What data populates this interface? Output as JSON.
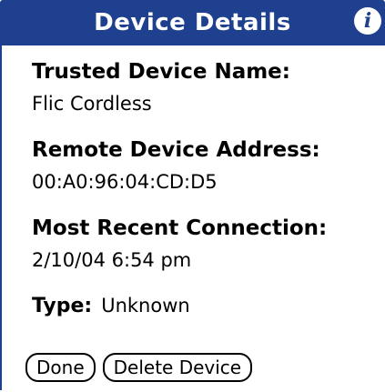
{
  "header": {
    "title": "Device Details",
    "info_icon": "info-icon",
    "bar_color": "#1f3f8f"
  },
  "details": {
    "trusted_name_label": "Trusted Device Name:",
    "trusted_name_value": "Flic Cordless",
    "address_label": "Remote Device Address:",
    "address_value": "00:A0:96:04:CD:D5",
    "recent_label": "Most Recent Connection:",
    "recent_value": "2/10/04 6:54 pm",
    "type_label": "Type:",
    "type_value": "Unknown"
  },
  "buttons": {
    "done_label": "Done",
    "delete_label": "Delete Device"
  }
}
